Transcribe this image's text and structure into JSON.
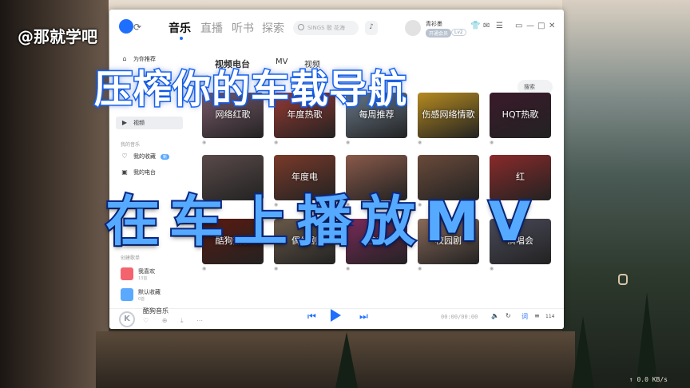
{
  "overlay": {
    "watermark": "@那就学吧",
    "title": "压榨你的车载导航",
    "subtitle": "在车上播放MV",
    "title_stroke_color": "#1a6bff",
    "subtitle_fill_color": "#55aaff"
  },
  "app": {
    "name": "酷狗音乐",
    "accent_color": "#1f6fff",
    "nav": [
      "音乐",
      "直播",
      "听书",
      "探索"
    ],
    "search_placeholder": "SINGS 歌 花海",
    "user": {
      "name": "青衫墨",
      "vip_label": "开通会员",
      "level": "Lv2"
    }
  },
  "sidebar": {
    "items": [
      {
        "label": "为你推荐",
        "icon": "home-icon"
      },
      {
        "label": "视频",
        "icon": "video-icon"
      }
    ],
    "my_music_caption": "我的音乐",
    "my_items": [
      {
        "label": "我的收藏",
        "icon": "heart-icon",
        "badge": "新"
      },
      {
        "label": "我的电台",
        "icon": "radio-icon"
      }
    ],
    "playlist_caption": "创建歌单",
    "playlists": [
      {
        "label": "我喜欢",
        "sub": "13首",
        "color": "#f4646e"
      },
      {
        "label": "默认收藏",
        "sub": "0首",
        "color": "#5aa9ff"
      }
    ]
  },
  "content": {
    "tabs": [
      "视频电台",
      "MV",
      "视频"
    ],
    "search_hint": "搜索",
    "row1": [
      {
        "label": "网络红歌",
        "color": "#7a5a6a"
      },
      {
        "label": "年度热歌",
        "color": "#9a3a32"
      },
      {
        "label": "每周推荐",
        "color": "#6a7a8a"
      },
      {
        "label": "伤感网络情歌",
        "color": "#b58a20"
      },
      {
        "label": "HQT热歌",
        "color": "#3a1a2a"
      }
    ],
    "row2": [
      {
        "label": "",
        "color": "#5a4a4a"
      },
      {
        "label": "年度电",
        "color": "#7a3a2a"
      },
      {
        "label": "",
        "color": "#8a5a4a"
      },
      {
        "label": "",
        "color": "#6a4a3a"
      },
      {
        "label": "红",
        "color": "#8a2a2a"
      }
    ],
    "row3": [
      {
        "label": "酷狗热歌",
        "color": "#5a1a10"
      },
      {
        "label": "偶像剧",
        "color": "#6a5a4a"
      },
      {
        "label": "热舞",
        "color": "#7a2a5a"
      },
      {
        "label": "校园剧",
        "color": "#8a6a5a"
      },
      {
        "label": "演唱会",
        "color": "#4a4a5a"
      }
    ]
  },
  "player": {
    "logo_letter": "K",
    "title": "酷狗音乐",
    "time": "00:00/00:00",
    "lyric": "词",
    "count": "114"
  },
  "system": {
    "net_speed": "↑ 0.0 KB/s"
  }
}
